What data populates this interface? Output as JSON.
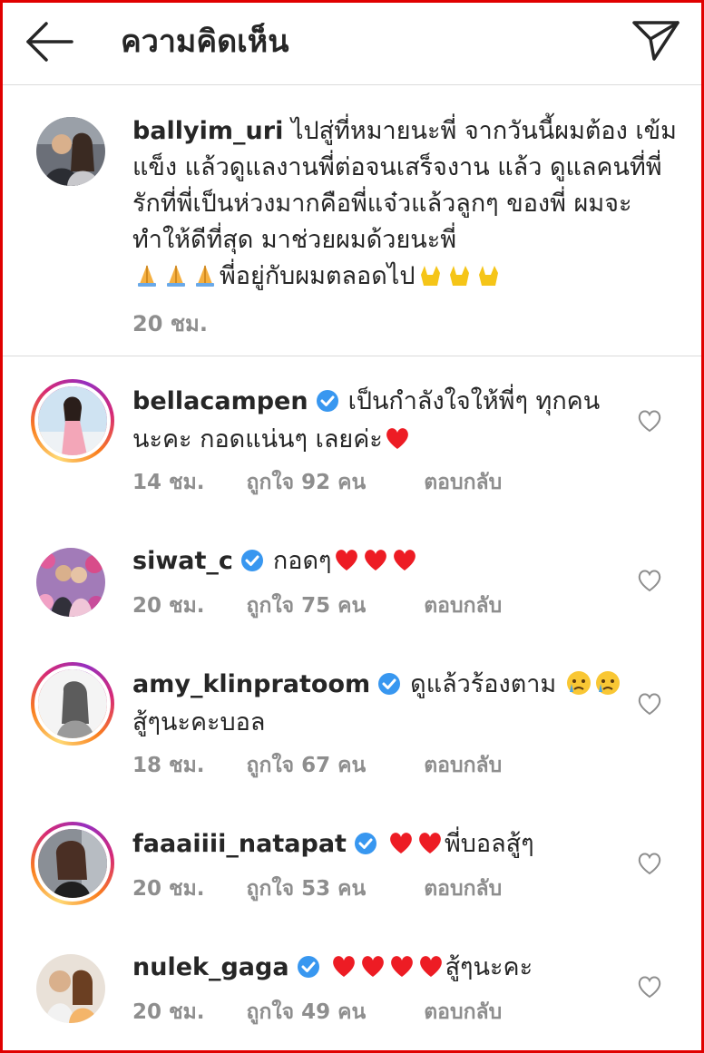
{
  "header": {
    "title": "ความคิดเห็น"
  },
  "caption": {
    "username": "ballyim_uri",
    "text_line1": "ไปสู่ที่หมายนะพี่ จากวันนี้ผมต้อง",
    "text_rest": "เข้มแข็ง แล้วดูแลงานพี่ต่อจนเสร็จงาน แล้ว ดูแลคนที่พี่รักที่พี่เป็นห่วงมากคือพี่แจ๋วแล้วลูกๆ ของพี่ ผมจะทำให้ดีที่สุด มาช่วยผมด้วยนะพี่",
    "text_end": "พี่อยู่กับผมตลอดไป",
    "emoji_pray": "pray-emoji",
    "emoji_rock": "love-you-gesture-emoji",
    "time": "20 ชม."
  },
  "comments": [
    {
      "username": "bellacampen",
      "verified": true,
      "text": "เป็นกำลังใจให้พี่ๆ ทุกคน นะคะ กอดแน่นๆ เลยค่ะ",
      "emoji": "red-heart-emoji",
      "time": "14 ชม.",
      "likes": "ถูกใจ 92 คน",
      "reply": "ตอบกลับ"
    },
    {
      "username": "siwat_c",
      "verified": true,
      "text": "กอดๆ",
      "emoji": "red-heart-emoji",
      "time": "20 ชม.",
      "likes": "ถูกใจ 75 คน",
      "reply": "ตอบกลับ"
    },
    {
      "username": "amy_klinpratoom",
      "verified": true,
      "text": "ดูแล้วร้องตาม",
      "text2": "สู้ๆนะคะบอล",
      "emoji": "crying-face-emoji",
      "time": "18 ชม.",
      "likes": "ถูกใจ 67 คน",
      "reply": "ตอบกลับ"
    },
    {
      "username": "faaaiiii_natapat",
      "verified": true,
      "text": "พี่บอลสู้ๆ",
      "emoji": "red-heart-emoji",
      "time": "20 ชม.",
      "likes": "ถูกใจ 53 คน",
      "reply": "ตอบกลับ"
    },
    {
      "username": "nulek_gaga",
      "verified": true,
      "text": "สู้ๆนะคะ",
      "emoji": "red-heart-emoji",
      "time": "20 ชม.",
      "likes": "ถูกใจ 49 คน",
      "reply": "ตอบกลับ"
    }
  ],
  "colors": {
    "accent": "#3897f0",
    "heart": "#ed1c24",
    "muted": "#8e8e8e"
  }
}
